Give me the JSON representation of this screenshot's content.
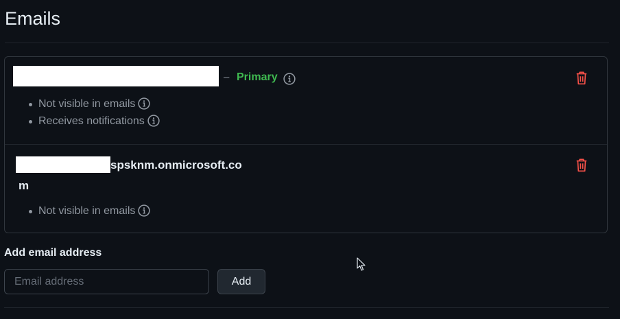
{
  "page": {
    "title": "Emails"
  },
  "emails": [
    {
      "address_suffix": "",
      "primary_separator": "–",
      "primary_label": "Primary",
      "notes": [
        "Not visible in emails",
        "Receives notifications"
      ]
    },
    {
      "address_suffix_line1": "spsknm.onmicrosoft.co",
      "address_suffix_line2": "m",
      "notes": [
        "Not visible in emails"
      ]
    }
  ],
  "add_email": {
    "label": "Add email address",
    "placeholder": "Email address",
    "button_label": "Add"
  },
  "icons": {
    "info": "info-icon",
    "delete": "trash-icon",
    "cursor": "mouse-pointer-icon"
  },
  "colors": {
    "background": "#0d1117",
    "primary_green": "#3fb950",
    "danger_red": "#f85149",
    "muted_text": "#9198a1",
    "border": "#30363d"
  }
}
